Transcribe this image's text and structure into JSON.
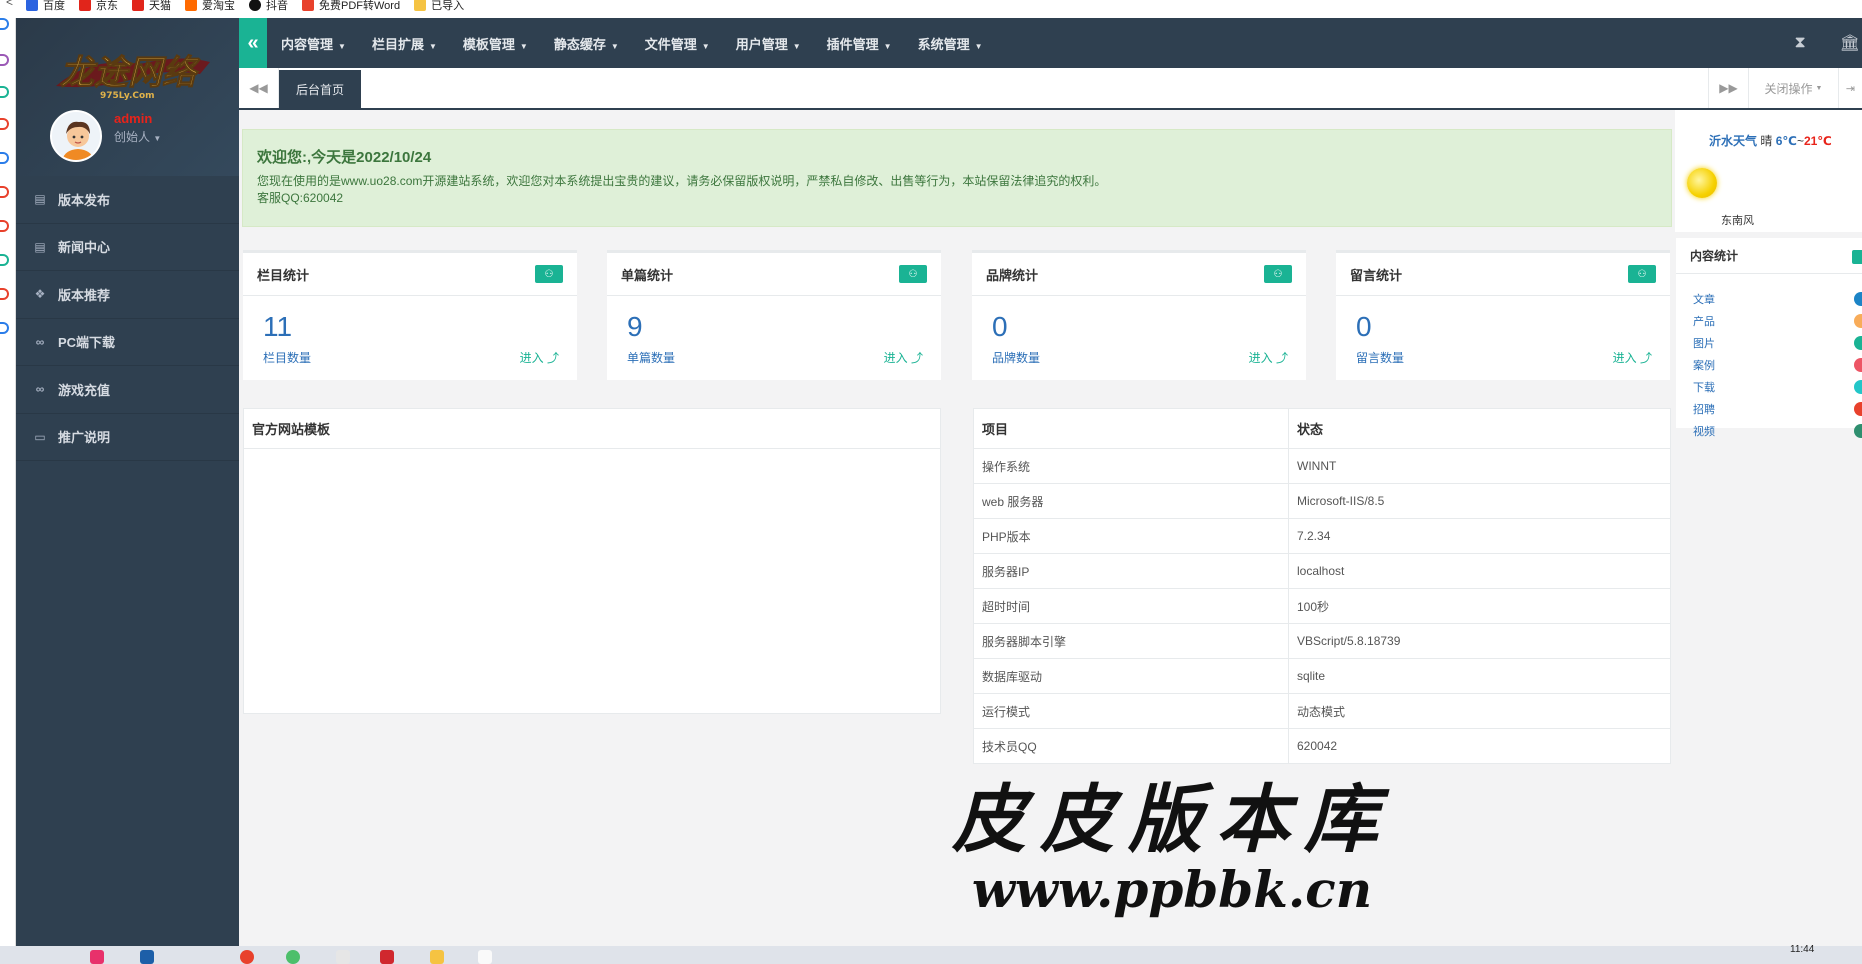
{
  "bookmarks": [
    {
      "label": "百度",
      "color": "#2b63e0"
    },
    {
      "label": "京东",
      "color": "#e1251b"
    },
    {
      "label": "天猫",
      "color": "#e1251b"
    },
    {
      "label": "爱淘宝",
      "color": "#ff6a00"
    },
    {
      "label": "抖音",
      "color": "#111111"
    },
    {
      "label": "免费PDF转Word",
      "color": "#e8412c"
    },
    {
      "label": "已导入",
      "color": "#f5c342"
    }
  ],
  "sidebar": {
    "logo_text": "龙途网络",
    "logo_subtext": "975Ly.Com",
    "user_name": "admin",
    "user_role": "创始人",
    "items": [
      {
        "label": "版本发布",
        "icon": "newspaper-icon"
      },
      {
        "label": "新闻中心",
        "icon": "newspaper-icon"
      },
      {
        "label": "版本推荐",
        "icon": "cubes-icon"
      },
      {
        "label": "PC端下载",
        "icon": "link-icon"
      },
      {
        "label": "游戏充值",
        "icon": "link-icon"
      },
      {
        "label": "推广说明",
        "icon": "desktop-icon"
      }
    ]
  },
  "topnav": {
    "menus": [
      "内容管理",
      "栏目扩展",
      "模板管理",
      "静态缓存",
      "文件管理",
      "用户管理",
      "插件管理",
      "系统管理"
    ]
  },
  "tabs": {
    "home": "后台首页",
    "close_ops": "关闭操作"
  },
  "welcome": {
    "title": "欢迎您:,今天是2022/10/24",
    "line1": "您现在使用的是www.uo28.com开源建站系统，欢迎您对本系统提出宝贵的建议，请务必保留版权说明，严禁私自修改、出售等行为，本站保留法律追究的权利。",
    "line2": "客服QQ:620042"
  },
  "stats": [
    {
      "title": "栏目统计",
      "value": "11",
      "label": "栏目数量",
      "enter": "进入"
    },
    {
      "title": "单篇统计",
      "value": "9",
      "label": "单篇数量",
      "enter": "进入"
    },
    {
      "title": "品牌统计",
      "value": "0",
      "label": "品牌数量",
      "enter": "进入"
    },
    {
      "title": "留言统计",
      "value": "0",
      "label": "留言数量",
      "enter": "进入"
    }
  ],
  "template_panel": {
    "title": "官方网站模板"
  },
  "info_table": {
    "headers": [
      "项目",
      "状态"
    ],
    "rows": [
      [
        "操作系统",
        "WINNT"
      ],
      [
        "web 服务器",
        "Microsoft-IIS/8.5"
      ],
      [
        "PHP版本",
        "7.2.34"
      ],
      [
        "服务器IP",
        "localhost"
      ],
      [
        "超时时间",
        "100秒"
      ],
      [
        "服务器脚本引擎",
        "VBScript/5.8.18739"
      ],
      [
        "数据库驱动",
        "sqlite"
      ],
      [
        "运行模式",
        "动态模式"
      ],
      [
        "技术员QQ",
        "620042"
      ]
    ]
  },
  "weather": {
    "city": "沂水天气",
    "condition": "晴",
    "low": "6℃",
    "sep": "~",
    "high": "21℃",
    "wind": "东南风"
  },
  "content_stats": {
    "title": "内容统计",
    "items": [
      {
        "label": "文章",
        "color": "#1c84c6"
      },
      {
        "label": "产品",
        "color": "#f8ac59"
      },
      {
        "label": "图片",
        "color": "#1ab394"
      },
      {
        "label": "案例",
        "color": "#ed5565"
      },
      {
        "label": "下载",
        "color": "#23c6c8"
      },
      {
        "label": "招聘",
        "color": "#e8412c"
      },
      {
        "label": "视频",
        "color": "#2f8f6f"
      }
    ]
  },
  "watermark": {
    "title": "皮皮版本库",
    "url": "www.ppbbk.cn"
  },
  "taskbar": {
    "clock": "11:44"
  },
  "colors": {
    "sidebar": "#2f4050",
    "accent": "#1ab394",
    "link": "#2c6fb7",
    "alert_bg": "#dff0d8"
  }
}
